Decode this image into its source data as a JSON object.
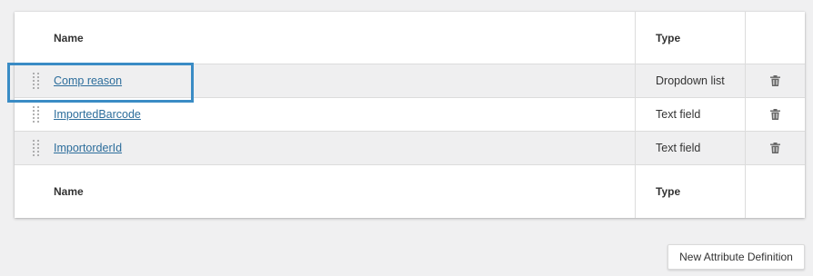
{
  "table": {
    "header": {
      "name": "Name",
      "type": "Type"
    },
    "footer": {
      "name": "Name",
      "type": "Type"
    },
    "rows": [
      {
        "name": "Comp reason",
        "type": "Dropdown list",
        "icon": "trash-icon"
      },
      {
        "name": "ImportedBarcode",
        "type": "Text field",
        "icon": "trash-icon"
      },
      {
        "name": "ImportorderId",
        "type": "Text field",
        "icon": "trash-icon"
      }
    ]
  },
  "actions": {
    "new_button_label": "New Attribute Definition"
  },
  "colors": {
    "link": "#2c6d9b",
    "highlight": "#3a8cc5",
    "stripe": "#efeff0",
    "background": "#f0f0f1"
  }
}
